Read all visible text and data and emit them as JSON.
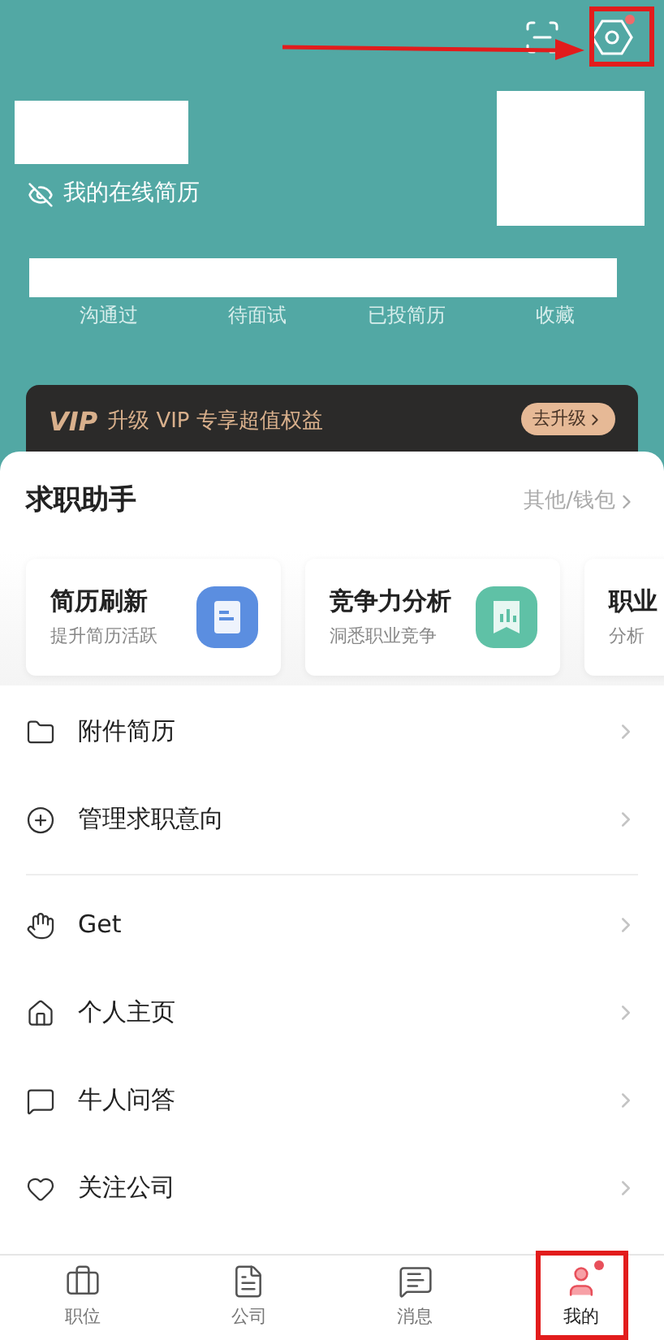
{
  "header": {
    "online_resume": "我的在线简历",
    "stats": [
      {
        "label": "沟通过"
      },
      {
        "label": "待面试"
      },
      {
        "label": "已投简历"
      },
      {
        "label": "收藏"
      }
    ],
    "settings_badge": true
  },
  "vip_banner": {
    "logo": "VIP",
    "text": "升级 VIP 专享超值权益",
    "button": "去升级"
  },
  "assistant": {
    "title": "求职助手",
    "link": "其他/钱包",
    "cards": [
      {
        "title": "简历刷新",
        "subtitle": "提升简历活跃",
        "kind": "resume"
      },
      {
        "title": "竞争力分析",
        "subtitle": "洞悉职业竞争",
        "kind": "chart"
      },
      {
        "title": "职业",
        "subtitle": "分析",
        "kind": "none"
      }
    ]
  },
  "menu_groups": [
    [
      {
        "label": "附件简历",
        "kind": "folder"
      },
      {
        "label": "管理求职意向",
        "kind": "plus"
      }
    ],
    [
      {
        "label": "Get",
        "kind": "hand"
      },
      {
        "label": "个人主页",
        "kind": "home"
      },
      {
        "label": "牛人问答",
        "kind": "chat"
      },
      {
        "label": "关注公司",
        "kind": "heart"
      }
    ]
  ],
  "tab_bar": [
    {
      "label": "职位",
      "kind": "job",
      "selected": false
    },
    {
      "label": "公司",
      "kind": "company",
      "selected": false
    },
    {
      "label": "消息",
      "kind": "message",
      "selected": false
    },
    {
      "label": "我的",
      "kind": "me",
      "selected": true,
      "badge": true
    }
  ],
  "annotations": [
    {
      "kind": "arrow"
    },
    {
      "kind": "topbox"
    },
    {
      "kind": "tabbox"
    }
  ]
}
